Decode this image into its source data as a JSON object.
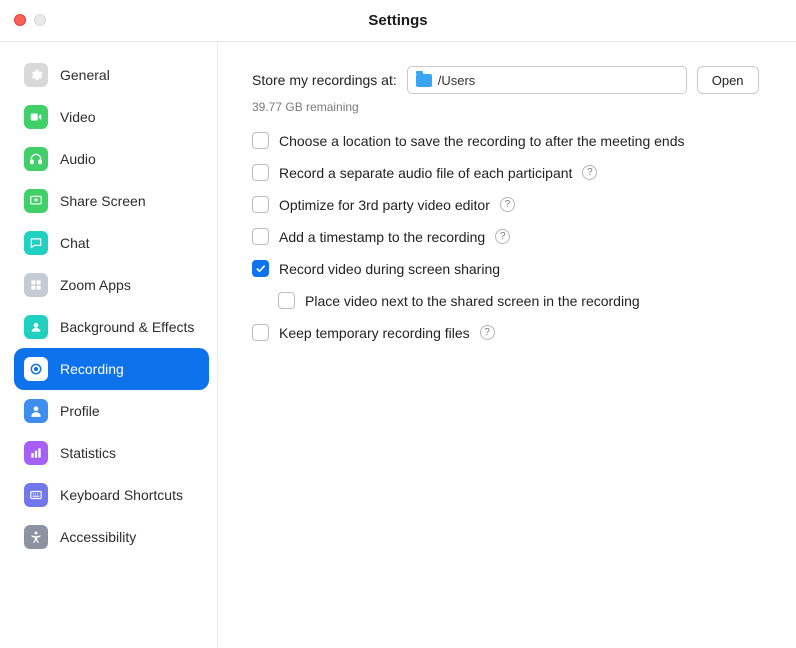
{
  "window": {
    "title": "Settings"
  },
  "sidebar": {
    "items": [
      {
        "label": "General",
        "icon": "gear-icon",
        "bg": "#d9d9d9",
        "fg": "#ffffff"
      },
      {
        "label": "Video",
        "icon": "video-icon",
        "bg": "#41cf6a",
        "fg": "#ffffff"
      },
      {
        "label": "Audio",
        "icon": "headphones-icon",
        "bg": "#41cf6a",
        "fg": "#ffffff"
      },
      {
        "label": "Share Screen",
        "icon": "share-screen-icon",
        "bg": "#41cf6a",
        "fg": "#ffffff"
      },
      {
        "label": "Chat",
        "icon": "chat-icon",
        "bg": "#20d0c0",
        "fg": "#ffffff"
      },
      {
        "label": "Zoom Apps",
        "icon": "apps-icon",
        "bg": "#c5cbd2",
        "fg": "#ffffff"
      },
      {
        "label": "Background & Effects",
        "icon": "background-icon",
        "bg": "#20d0c0",
        "fg": "#ffffff"
      },
      {
        "label": "Recording",
        "icon": "record-icon",
        "bg": "#ffffff",
        "fg": "#0e72ec",
        "active": true
      },
      {
        "label": "Profile",
        "icon": "profile-icon",
        "bg": "#3e8ef0",
        "fg": "#ffffff"
      },
      {
        "label": "Statistics",
        "icon": "statistics-icon",
        "bg": "#a55ff5",
        "fg": "#ffffff"
      },
      {
        "label": "Keyboard Shortcuts",
        "icon": "keyboard-icon",
        "bg": "#7277ec",
        "fg": "#ffffff"
      },
      {
        "label": "Accessibility",
        "icon": "accessibility-icon",
        "bg": "#8d92a3",
        "fg": "#ffffff"
      }
    ]
  },
  "main": {
    "store_label": "Store my recordings at:",
    "path_value": "/Users",
    "open_label": "Open",
    "remaining": "39.77 GB remaining",
    "options": [
      {
        "label": "Choose a location to save the recording to after the meeting ends",
        "checked": false,
        "help": false,
        "indent": false
      },
      {
        "label": "Record a separate audio file of each participant",
        "checked": false,
        "help": true,
        "indent": false
      },
      {
        "label": "Optimize for 3rd party video editor",
        "checked": false,
        "help": true,
        "indent": false
      },
      {
        "label": "Add a timestamp to the recording",
        "checked": false,
        "help": true,
        "indent": false
      },
      {
        "label": "Record video during screen sharing",
        "checked": true,
        "help": false,
        "indent": false
      },
      {
        "label": "Place video next to the shared screen in the recording",
        "checked": false,
        "help": false,
        "indent": true
      },
      {
        "label": "Keep temporary recording files",
        "checked": false,
        "help": true,
        "indent": false
      }
    ]
  },
  "help_glyph": "?"
}
